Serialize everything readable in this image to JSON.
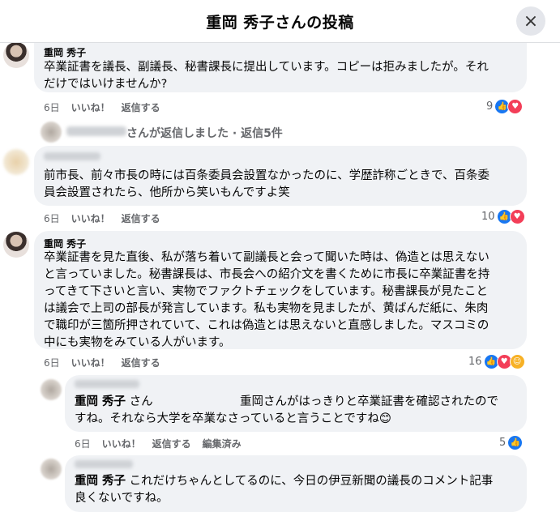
{
  "header": {
    "title": "重岡 秀子さんの投稿",
    "close_icon": "×"
  },
  "comment1": {
    "author": "重岡 秀子",
    "text1": "卒業証書を議長、副議長、秘書課長に提出しています。コピーは拒みましたが。それ",
    "text2": "だけではいけませんか?",
    "time": "6日",
    "like": "いいね！",
    "reply": "返信する",
    "count": "9"
  },
  "replies_link": "さんが返信しました · 返信5件",
  "comment2": {
    "text1": "前市長、前々市長の時には百条委員会設置なかったのに、学歴詐称ごときで、百条委",
    "text2": "員会設置されたら、他所から笑いもんですよ笑",
    "time": "6日",
    "like": "いいね！",
    "reply": "返信する",
    "count": "10"
  },
  "comment3": {
    "author": "重岡 秀子",
    "lines": [
      "卒業証書を見た直後、私が落ち着いて副議長と会って聞いた時は、偽造とは思えない",
      "と言っていました。秘書課長は、市長会への紹介文を書くために市長に卒業証書を持",
      "ってきて下さいと言い、実物でファクトチェックをしています。秘書課長が見たこと",
      "は議会で上司の部長が発言しています。私も実物を見ましたが、黄ばんだ紙に、朱肉",
      "で職印が三箇所押されていて、これは偽造とは思えないと直感しました。マスコミの",
      "中にも実物をみている人がいます。"
    ],
    "time": "6日",
    "like": "いいね！",
    "reply": "返信する",
    "count": "16"
  },
  "comment4": {
    "mention": "重岡 秀子",
    "san": "さん",
    "text1": "重岡さんがはっきりと卒業証書を確認されたので",
    "text2": "すね。それなら大学を卒業なさっていると言うことですね😊",
    "time": "6日",
    "like": "いいね！",
    "reply": "返信する",
    "edited": "編集済み",
    "count": "5"
  },
  "comment5": {
    "mention": "重岡 秀子",
    "text1": "これだけちゃんとしてるのに、今日の伊豆新聞の議長のコメント記事",
    "text2": "良くないですね。"
  }
}
